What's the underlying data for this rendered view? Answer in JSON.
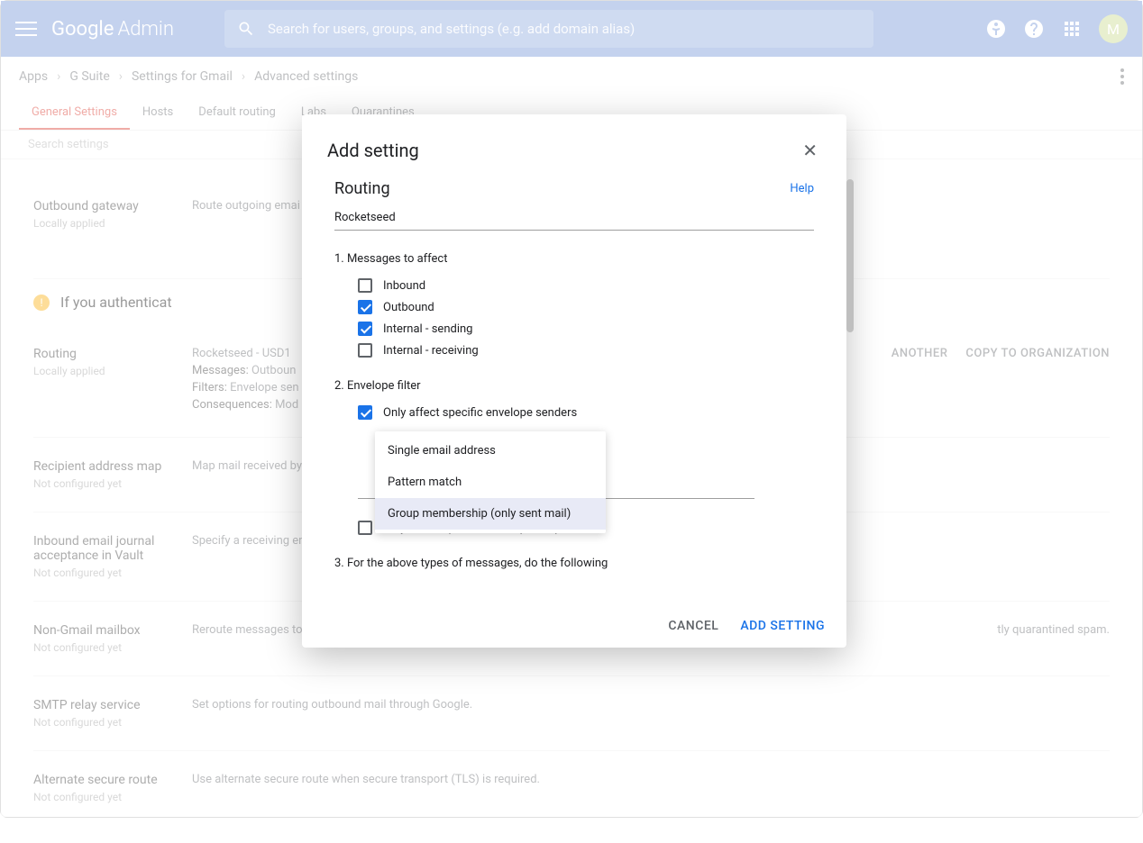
{
  "header": {
    "brand_a": "Google",
    "brand_b": "Admin",
    "search_placeholder": "Search for users, groups, and settings (e.g. add domain alias)",
    "avatar_letter": "M"
  },
  "breadcrumb": {
    "items": [
      "Apps",
      "G Suite",
      "Settings for Gmail",
      "Advanced settings"
    ]
  },
  "tabs": {
    "items": [
      "General Settings",
      "Hosts",
      "Default routing",
      "Labs",
      "Quarantines"
    ],
    "search_hint": "Search settings"
  },
  "settings": {
    "outbound_gateway": {
      "title": "Outbound gateway",
      "sub": "Locally applied",
      "desc": "Route outgoing emai"
    },
    "auth_note": "If you authenticat",
    "routing": {
      "title": "Routing",
      "sub": "Locally applied",
      "name": "Rocketseed - USD1",
      "messages_lbl": "Messages:",
      "messages_val": "Outboun",
      "filters_lbl": "Filters:",
      "filters_val": "Envelope sen",
      "cons_lbl": "Consequences:",
      "cons_val": "Mod"
    },
    "actions": {
      "another": "ANOTHER",
      "copy": "COPY TO ORGANIZATION"
    },
    "recipient_map": {
      "title": "Recipient address map",
      "sub": "Not configured yet",
      "desc": "Map mail received by"
    },
    "inbound_journal": {
      "title": "Inbound email journal acceptance in Vault",
      "sub": "Not configured yet",
      "desc": "Specify a receiving en"
    },
    "non_gmail": {
      "title": "Non-Gmail mailbox",
      "sub": "Not configured yet",
      "desc": "Reroute messages to",
      "trail": "tly quarantined spam."
    },
    "smtp_relay": {
      "title": "SMTP relay service",
      "sub": "Not configured yet",
      "desc": "Set options for routing outbound mail through Google."
    },
    "alt_route": {
      "title": "Alternate secure route",
      "sub": "Not configured yet",
      "desc": "Use alternate secure route when secure transport (TLS) is required."
    }
  },
  "dialog": {
    "title": "Add setting",
    "section": "Routing",
    "help": "Help",
    "input_value": "Rocketseed",
    "step1": "1. Messages to affect",
    "checks1": {
      "inbound": "Inbound",
      "outbound": "Outbound",
      "internal_sending": "Internal - sending",
      "internal_receiving": "Internal - receiving"
    },
    "step2": "2. Envelope filter",
    "env_senders": "Only affect specific envelope senders",
    "env_recipients": "Only affect specific envelope recipients",
    "step3": "3. For the above types of messages, do the following",
    "dropdown": {
      "opt1": "Single email address",
      "opt2": "Pattern match",
      "opt3": "Group membership (only sent mail)"
    },
    "cancel": "CANCEL",
    "add": "ADD SETTING"
  }
}
